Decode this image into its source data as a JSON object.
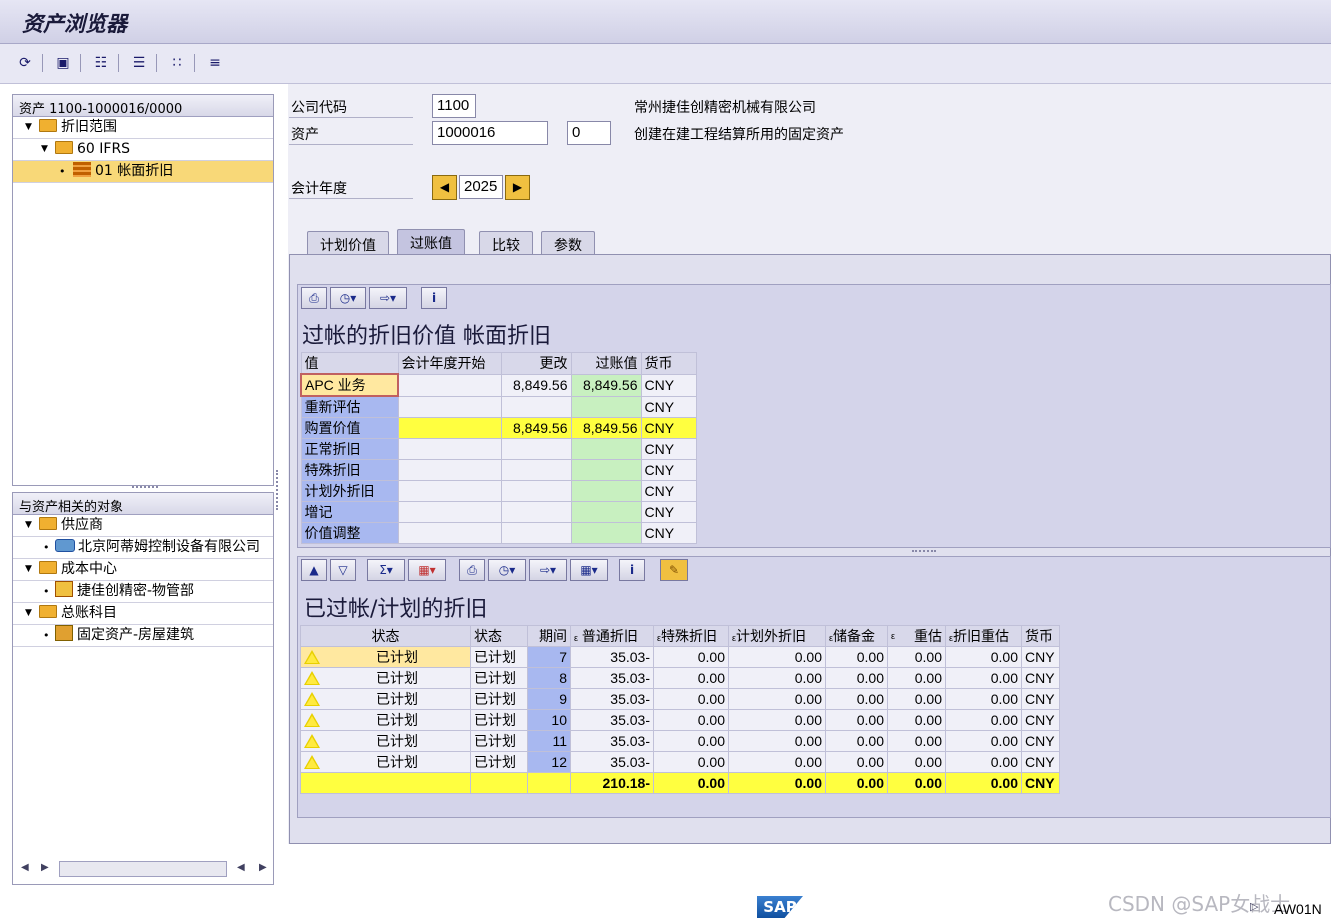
{
  "app": {
    "title": "资产浏览器"
  },
  "toolbar": {
    "buttons": [
      "refresh",
      "save",
      "hierarchy",
      "columns",
      "network",
      "list"
    ]
  },
  "tree": {
    "header": "资产 1100-1000016/0000",
    "depr_areas": "折旧范围",
    "area_60": "60  IFRS",
    "area_01": "01  帐面折旧"
  },
  "related": {
    "header": "与资产相关的对象",
    "vendor": "供应商",
    "vendor_item": "北京阿蒂姆控制设备有限公司",
    "cost_center": "成本中心",
    "cost_center_item": "捷佳创精密-物管部",
    "gl": "总账科目",
    "gl_item": "固定资产-房屋建筑"
  },
  "header_fields": {
    "company_label": "公司代码",
    "company_value": "1100",
    "company_name": "常州捷佳创精密机械有限公司",
    "asset_label": "资产",
    "asset_value": "1000016",
    "sub_value": "0",
    "asset_desc": "创建在建工程结算所用的固定资产",
    "fy_label": "会计年度",
    "fy_value": "2025"
  },
  "tabs": [
    "计划价值",
    "过账值",
    "比较",
    "参数"
  ],
  "grid1": {
    "title": "过帐的折旧价值 帐面折旧",
    "headers": [
      "值",
      "会计年度开始",
      "更改",
      "过账值",
      "货币"
    ],
    "rows": [
      [
        "APC 业务",
        "",
        "8,849.56",
        "8,849.56",
        "CNY"
      ],
      [
        "重新评估",
        "",
        "",
        "",
        "CNY"
      ],
      [
        "购置价值",
        "",
        "8,849.56",
        "8,849.56",
        "CNY"
      ],
      [
        "正常折旧",
        "",
        "",
        "",
        "CNY"
      ],
      [
        "特殊折旧",
        "",
        "",
        "",
        "CNY"
      ],
      [
        "计划外折旧",
        "",
        "",
        "",
        "CNY"
      ],
      [
        "增记",
        "",
        "",
        "",
        "CNY"
      ],
      [
        "价值调整",
        "",
        "",
        "",
        "CNY"
      ]
    ]
  },
  "grid2": {
    "title": "已过帐/计划的折旧",
    "headers": [
      "状态",
      "状态",
      "期间",
      "普通折旧",
      "特殊折旧",
      "计划外折旧",
      "储备金",
      "重估",
      "折旧重估",
      "货币"
    ],
    "header_prefix": "ε",
    "rows": [
      [
        "已计划",
        "已计划",
        "7",
        "35.03-",
        "0.00",
        "0.00",
        "0.00",
        "0.00",
        "0.00",
        "CNY"
      ],
      [
        "已计划",
        "已计划",
        "8",
        "35.03-",
        "0.00",
        "0.00",
        "0.00",
        "0.00",
        "0.00",
        "CNY"
      ],
      [
        "已计划",
        "已计划",
        "9",
        "35.03-",
        "0.00",
        "0.00",
        "0.00",
        "0.00",
        "0.00",
        "CNY"
      ],
      [
        "已计划",
        "已计划",
        "10",
        "35.03-",
        "0.00",
        "0.00",
        "0.00",
        "0.00",
        "0.00",
        "CNY"
      ],
      [
        "已计划",
        "已计划",
        "11",
        "35.03-",
        "0.00",
        "0.00",
        "0.00",
        "0.00",
        "0.00",
        "CNY"
      ],
      [
        "已计划",
        "已计划",
        "12",
        "35.03-",
        "0.00",
        "0.00",
        "0.00",
        "0.00",
        "0.00",
        "CNY"
      ]
    ],
    "total": [
      "210.18-",
      "0.00",
      "0.00",
      "0.00",
      "0.00",
      "0.00",
      "CNY"
    ]
  },
  "status": {
    "sap_logo": "SAP",
    "tcode": "AW01N",
    "watermark": "CSDN @SAP女战士"
  },
  "colors": {
    "accent": "#c4c4e0",
    "highlight": "#ffff40",
    "posted": "#c8f0c0",
    "period": "#a8b8f0"
  }
}
